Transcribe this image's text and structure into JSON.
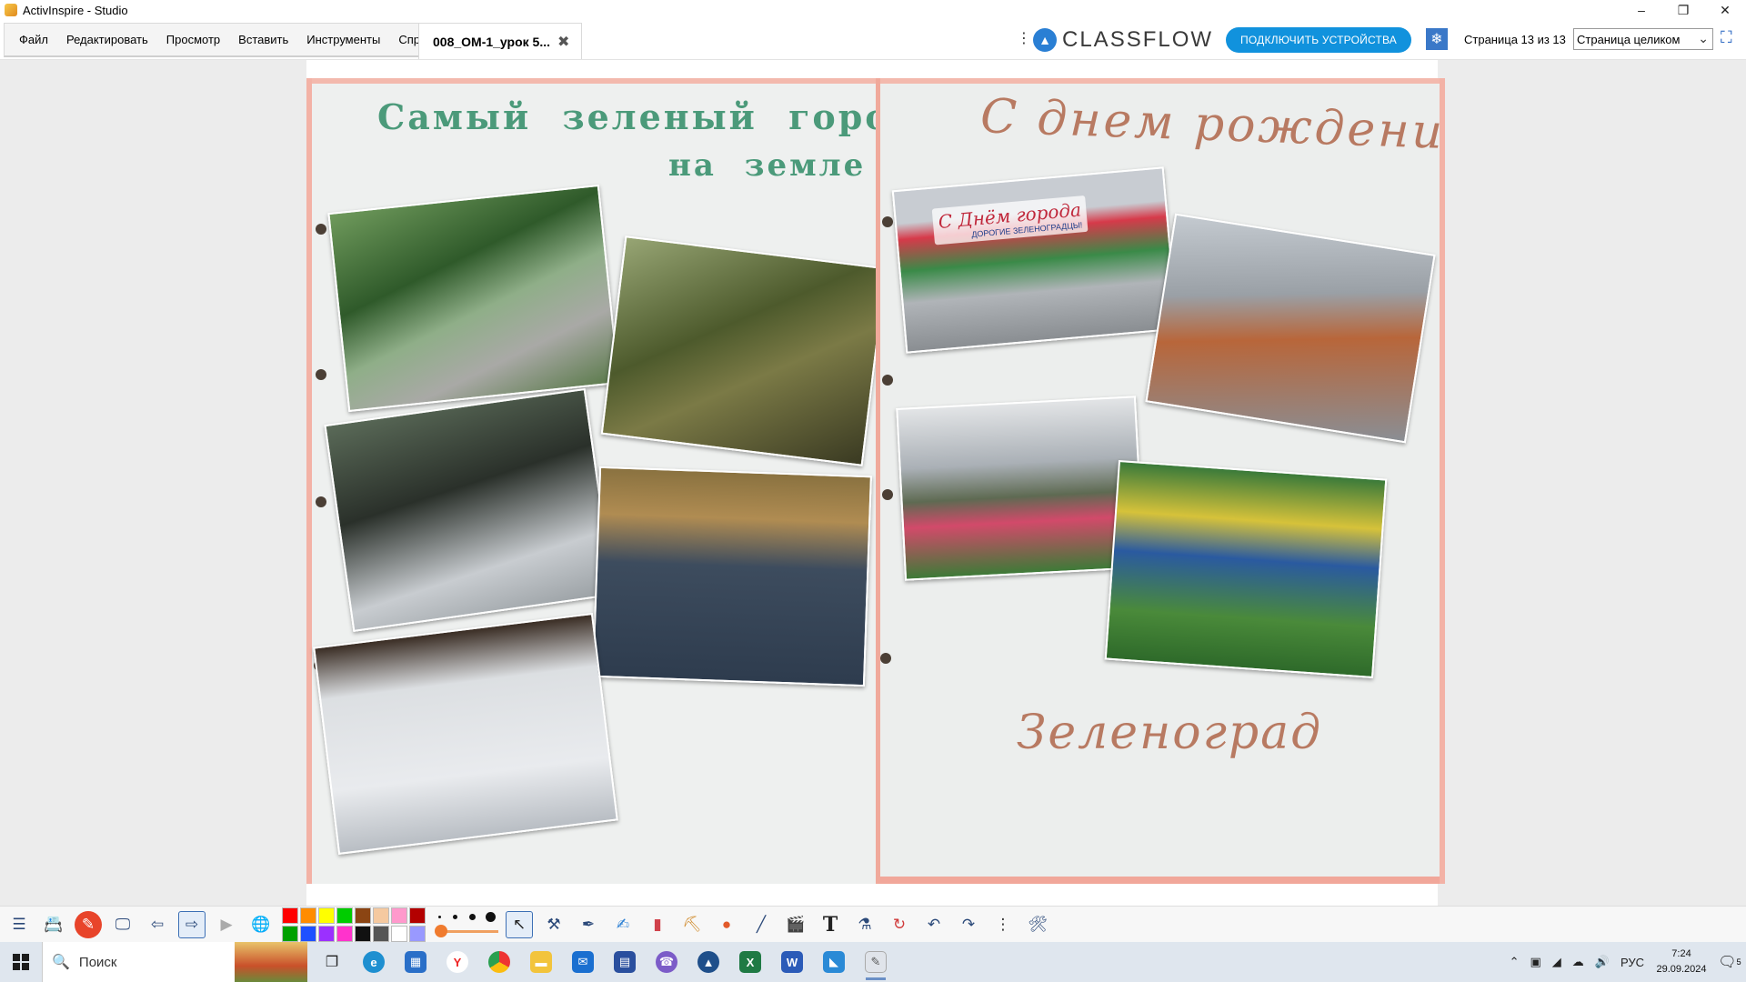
{
  "window": {
    "title": "ActivInspire - Studio"
  },
  "menu": {
    "items": [
      "Файл",
      "Редактировать",
      "Просмотр",
      "Вставить",
      "Инструменты",
      "Справка"
    ]
  },
  "document_tab": {
    "title": "008_ОМ-1_урок 5..."
  },
  "header": {
    "brand": "CLASSFLOW",
    "connect_label": "ПОДКЛЮЧИТЬ УСТРОЙСТВА",
    "page_indicator": "Страница 13 из 13",
    "zoom_value": "Страница целиком"
  },
  "page_content": {
    "left_title_line1": "Самый зеленый город",
    "left_title_line2": "на земле",
    "right_title": "С днем рождения,",
    "right_footer": "Зеленоград",
    "banner_text": "С Днём города",
    "banner_subtext": "ДОРОГИЕ ЗЕЛЕНОГРАДЦЫ!"
  },
  "palette": {
    "colors": [
      "#ff0000",
      "#ff8c00",
      "#ffff00",
      "#00cc00",
      "#8b4513",
      "#f5c9a0",
      "#ff99cc",
      "#b30000",
      "#00a000",
      "#1e50ff",
      "#9b30ff",
      "#ff33cc",
      "#111111",
      "#555555",
      "#ffffff",
      "#9999ff"
    ]
  },
  "taskbar": {
    "search_placeholder": "Поиск",
    "language": "РУС",
    "time": "7:24",
    "date": "29.09.2024",
    "notification_count": "5"
  }
}
